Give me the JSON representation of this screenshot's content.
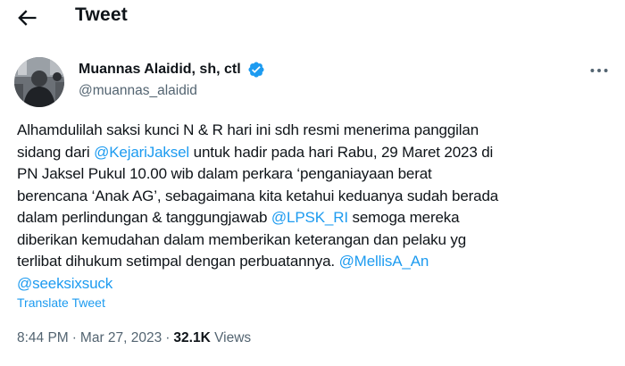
{
  "header": {
    "title": "Tweet",
    "back_icon": "back-arrow-icon"
  },
  "author": {
    "display_name": "Muannas Alaidid, sh, ctl",
    "handle": "@muannas_alaidid",
    "verified_icon": "verified-badge-icon",
    "verified_color": "#1d9bf0"
  },
  "more_icon": "more-horizontal-icon",
  "tweet": {
    "lines": [
      [
        {
          "text": "Alhamdulilah saksi kunci N & R hari ini sdh resmi menerima panggilan",
          "link": false
        }
      ],
      [
        {
          "text": "sidang dari ",
          "link": false
        },
        {
          "text": "@KejariJaksel",
          "link": true
        },
        {
          "text": " untuk hadir pada hari Rabu, 29 Maret 2023 di",
          "link": false
        }
      ],
      [
        {
          "text": "PN Jaksel Pukul 10.00 wib dalam perkara ‘penganiayaan berat",
          "link": false
        }
      ],
      [
        {
          "text": "berencana ‘Anak AG’, sebagaimana kita ketahui keduanya sudah berada",
          "link": false
        }
      ],
      [
        {
          "text": "dalam perlindungan & tanggungjawab ",
          "link": false
        },
        {
          "text": "@LPSK_RI",
          "link": true
        },
        {
          "text": " semoga mereka",
          "link": false
        }
      ],
      [
        {
          "text": "diberikan kemudahan dalam memberikan keterangan dan pelaku yg",
          "link": false
        }
      ],
      [
        {
          "text": "terlibat dihukum setimpal dengan perbuatannya. ",
          "link": false
        },
        {
          "text": "@MellisA_An",
          "link": true
        }
      ],
      [
        {
          "text": "@seeksixsuck",
          "link": true
        }
      ]
    ]
  },
  "translate_label": "Translate Tweet",
  "meta": {
    "time": "8:44 PM",
    "separator": "·",
    "date": "Mar 27, 2023",
    "views_count": "32.1K",
    "views_label": "Views"
  },
  "colors": {
    "link": "#1d9bf0",
    "secondary_text": "#536471",
    "primary_text": "#0f1419"
  }
}
